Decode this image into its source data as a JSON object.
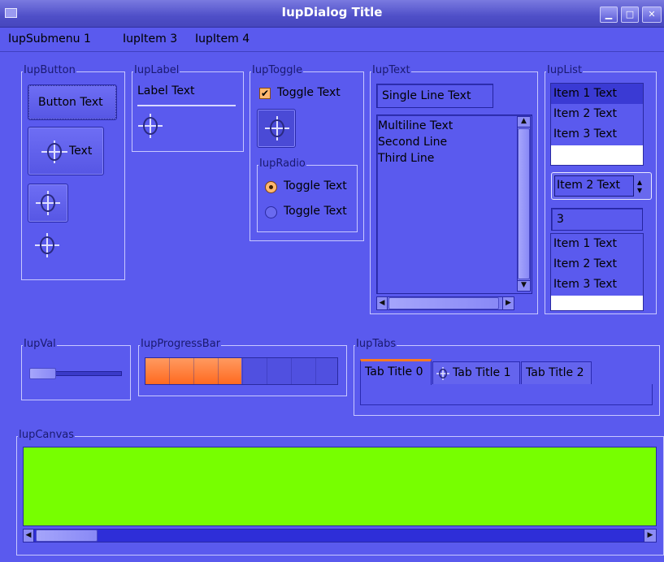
{
  "window": {
    "title": "IupDialog Title"
  },
  "menu": [
    "IupSubmenu 1",
    "IupItem 3",
    "IupItem 4"
  ],
  "frames": {
    "button": "IupButton",
    "label": "IupLabel",
    "toggle": "IupToggle",
    "radio": "IupRadio",
    "text": "IupText",
    "list": "IupList",
    "val": "IupVal",
    "progress": "IupProgressBar",
    "tabs": "IupTabs",
    "canvas": "IupCanvas"
  },
  "buttons": {
    "text_button": "Button Text",
    "icon_text_button": "Text"
  },
  "label": {
    "text": "Label Text"
  },
  "toggle": {
    "label": "Toggle Text",
    "checked": true
  },
  "radio": [
    {
      "label": "Toggle Text",
      "selected": true
    },
    {
      "label": "Toggle Text",
      "selected": false
    }
  ],
  "text": {
    "single_line": "Single Line Text",
    "multiline": [
      "Multiline Text",
      "Second Line",
      "Third Line"
    ]
  },
  "list": {
    "items": [
      "Item 1 Text",
      "Item 2 Text",
      "Item 3 Text"
    ],
    "selected_index": 0,
    "dropdown_value": "Item 2 Text",
    "edit_value": "3",
    "edit_items": [
      "Item 1 Text",
      "Item 2 Text",
      "Item 3 Text"
    ]
  },
  "val": {
    "value": 0.1
  },
  "progress": {
    "value": 0.5
  },
  "tabs": [
    "Tab Title 0",
    "Tab Title 1",
    "Tab Title 2"
  ],
  "colors": {
    "canvas": "#77ff00",
    "background": "#5a5aee",
    "progress_fill": "#ff7a3c"
  }
}
